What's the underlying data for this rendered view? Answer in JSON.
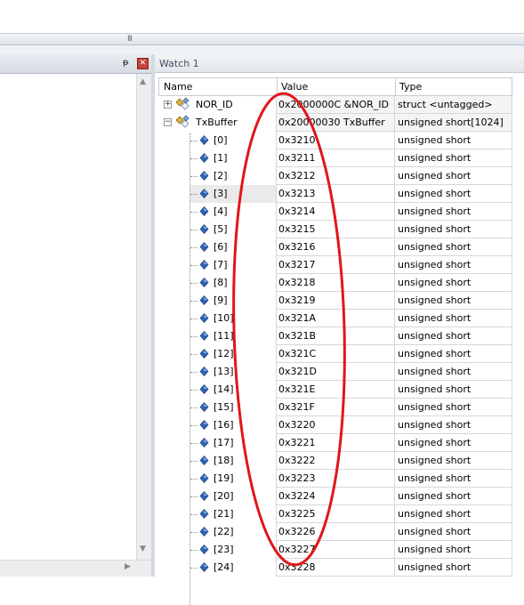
{
  "splitter": {
    "grip": "III"
  },
  "left_panel": {
    "pin": "ᵽ",
    "close": "✕"
  },
  "watch": {
    "title": "Watch 1",
    "columns": {
      "name": "Name",
      "value": "Value",
      "type": "Type"
    },
    "rows": [
      {
        "name": "NOR_ID",
        "value": "0x2000000C &NOR_ID",
        "type": "struct <untagged>",
        "expander": "+",
        "kind": "struct"
      },
      {
        "name": "TxBuffer",
        "value": "0x20000030 TxBuffer",
        "type": "unsigned short[1024]",
        "expander": "−",
        "kind": "array"
      },
      {
        "name": "[0]",
        "value": "0x3210",
        "type": "unsigned short"
      },
      {
        "name": "[1]",
        "value": "0x3211",
        "type": "unsigned short"
      },
      {
        "name": "[2]",
        "value": "0x3212",
        "type": "unsigned short"
      },
      {
        "name": "[3]",
        "value": "0x3213",
        "type": "unsigned short"
      },
      {
        "name": "[4]",
        "value": "0x3214",
        "type": "unsigned short"
      },
      {
        "name": "[5]",
        "value": "0x3215",
        "type": "unsigned short"
      },
      {
        "name": "[6]",
        "value": "0x3216",
        "type": "unsigned short"
      },
      {
        "name": "[7]",
        "value": "0x3217",
        "type": "unsigned short"
      },
      {
        "name": "[8]",
        "value": "0x3218",
        "type": "unsigned short"
      },
      {
        "name": "[9]",
        "value": "0x3219",
        "type": "unsigned short"
      },
      {
        "name": "[10]",
        "value": "0x321A",
        "type": "unsigned short"
      },
      {
        "name": "[11]",
        "value": "0x321B",
        "type": "unsigned short"
      },
      {
        "name": "[12]",
        "value": "0x321C",
        "type": "unsigned short"
      },
      {
        "name": "[13]",
        "value": "0x321D",
        "type": "unsigned short"
      },
      {
        "name": "[14]",
        "value": "0x321E",
        "type": "unsigned short"
      },
      {
        "name": "[15]",
        "value": "0x321F",
        "type": "unsigned short"
      },
      {
        "name": "[16]",
        "value": "0x3220",
        "type": "unsigned short"
      },
      {
        "name": "[17]",
        "value": "0x3221",
        "type": "unsigned short"
      },
      {
        "name": "[18]",
        "value": "0x3222",
        "type": "unsigned short"
      },
      {
        "name": "[19]",
        "value": "0x3223",
        "type": "unsigned short"
      },
      {
        "name": "[20]",
        "value": "0x3224",
        "type": "unsigned short"
      },
      {
        "name": "[21]",
        "value": "0x3225",
        "type": "unsigned short"
      },
      {
        "name": "[22]",
        "value": "0x3226",
        "type": "unsigned short"
      },
      {
        "name": "[23]",
        "value": "0x3227",
        "type": "unsigned short"
      },
      {
        "name": "[24]",
        "value": "0x3228",
        "type": "unsigned short"
      }
    ]
  },
  "colors": {
    "annotation_ellipse": "#e0161a",
    "element_diamond": "#2d63b8",
    "close_button": "#c5443d"
  },
  "icons": {
    "struct": "variable-struct-icon",
    "element": "element-diamond-icon"
  }
}
